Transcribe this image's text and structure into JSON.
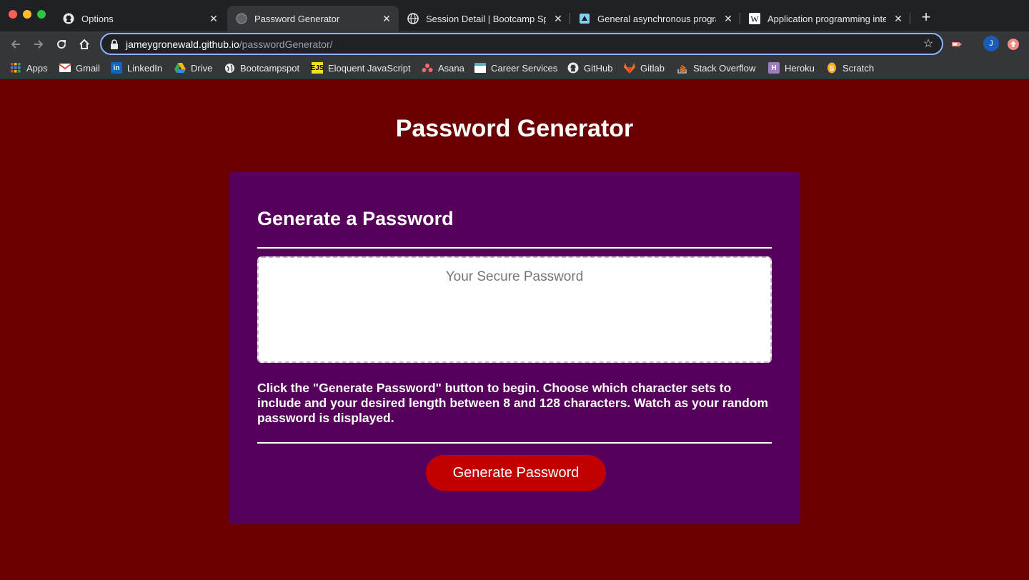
{
  "browser": {
    "tabs": [
      {
        "title": "Options",
        "icon": "github-icon",
        "active": false
      },
      {
        "title": "Password Generator",
        "icon": "globe-icon",
        "active": true
      },
      {
        "title": "Session Detail | Bootcamp Spo",
        "icon": "globe-icon",
        "active": false
      },
      {
        "title": "General asynchronous program",
        "icon": "site-icon",
        "active": false
      },
      {
        "title": "Application programming interf",
        "icon": "wikipedia-icon",
        "active": false
      }
    ],
    "url": {
      "host": "jameygronewald.github.io",
      "path": "/passwordGenerator/"
    },
    "profile_initial": "J",
    "bookmarks": [
      {
        "label": "Apps",
        "icon": "apps-grid-icon"
      },
      {
        "label": "Gmail",
        "icon": "gmail-icon"
      },
      {
        "label": "LinkedIn",
        "icon": "linkedin-icon"
      },
      {
        "label": "Drive",
        "icon": "drive-icon"
      },
      {
        "label": "Bootcampspot",
        "icon": "globe-icon"
      },
      {
        "label": "Eloquent JavaScript",
        "icon": "ejs-icon"
      },
      {
        "label": "Asana",
        "icon": "asana-icon"
      },
      {
        "label": "Career Services",
        "icon": "career-icon"
      },
      {
        "label": "GitHub",
        "icon": "github-icon"
      },
      {
        "label": "Gitlab",
        "icon": "gitlab-icon"
      },
      {
        "label": "Stack Overflow",
        "icon": "stackoverflow-icon"
      },
      {
        "label": "Heroku",
        "icon": "heroku-icon"
      },
      {
        "label": "Scratch",
        "icon": "scratch-icon"
      }
    ]
  },
  "page": {
    "title": "Password Generator",
    "card": {
      "header": "Generate a Password",
      "password_placeholder": "Your Secure Password",
      "password_value": "",
      "instructions": "Click the \"Generate Password\" button to begin. Choose which character sets to include and your desired length between 8 and 128 characters. Watch as your random password is displayed.",
      "button_label": "Generate Password"
    }
  },
  "colors": {
    "page_background": "#6b0000",
    "card_background": "#56005c",
    "button_background": "#c30000",
    "text": "#ffffff"
  }
}
